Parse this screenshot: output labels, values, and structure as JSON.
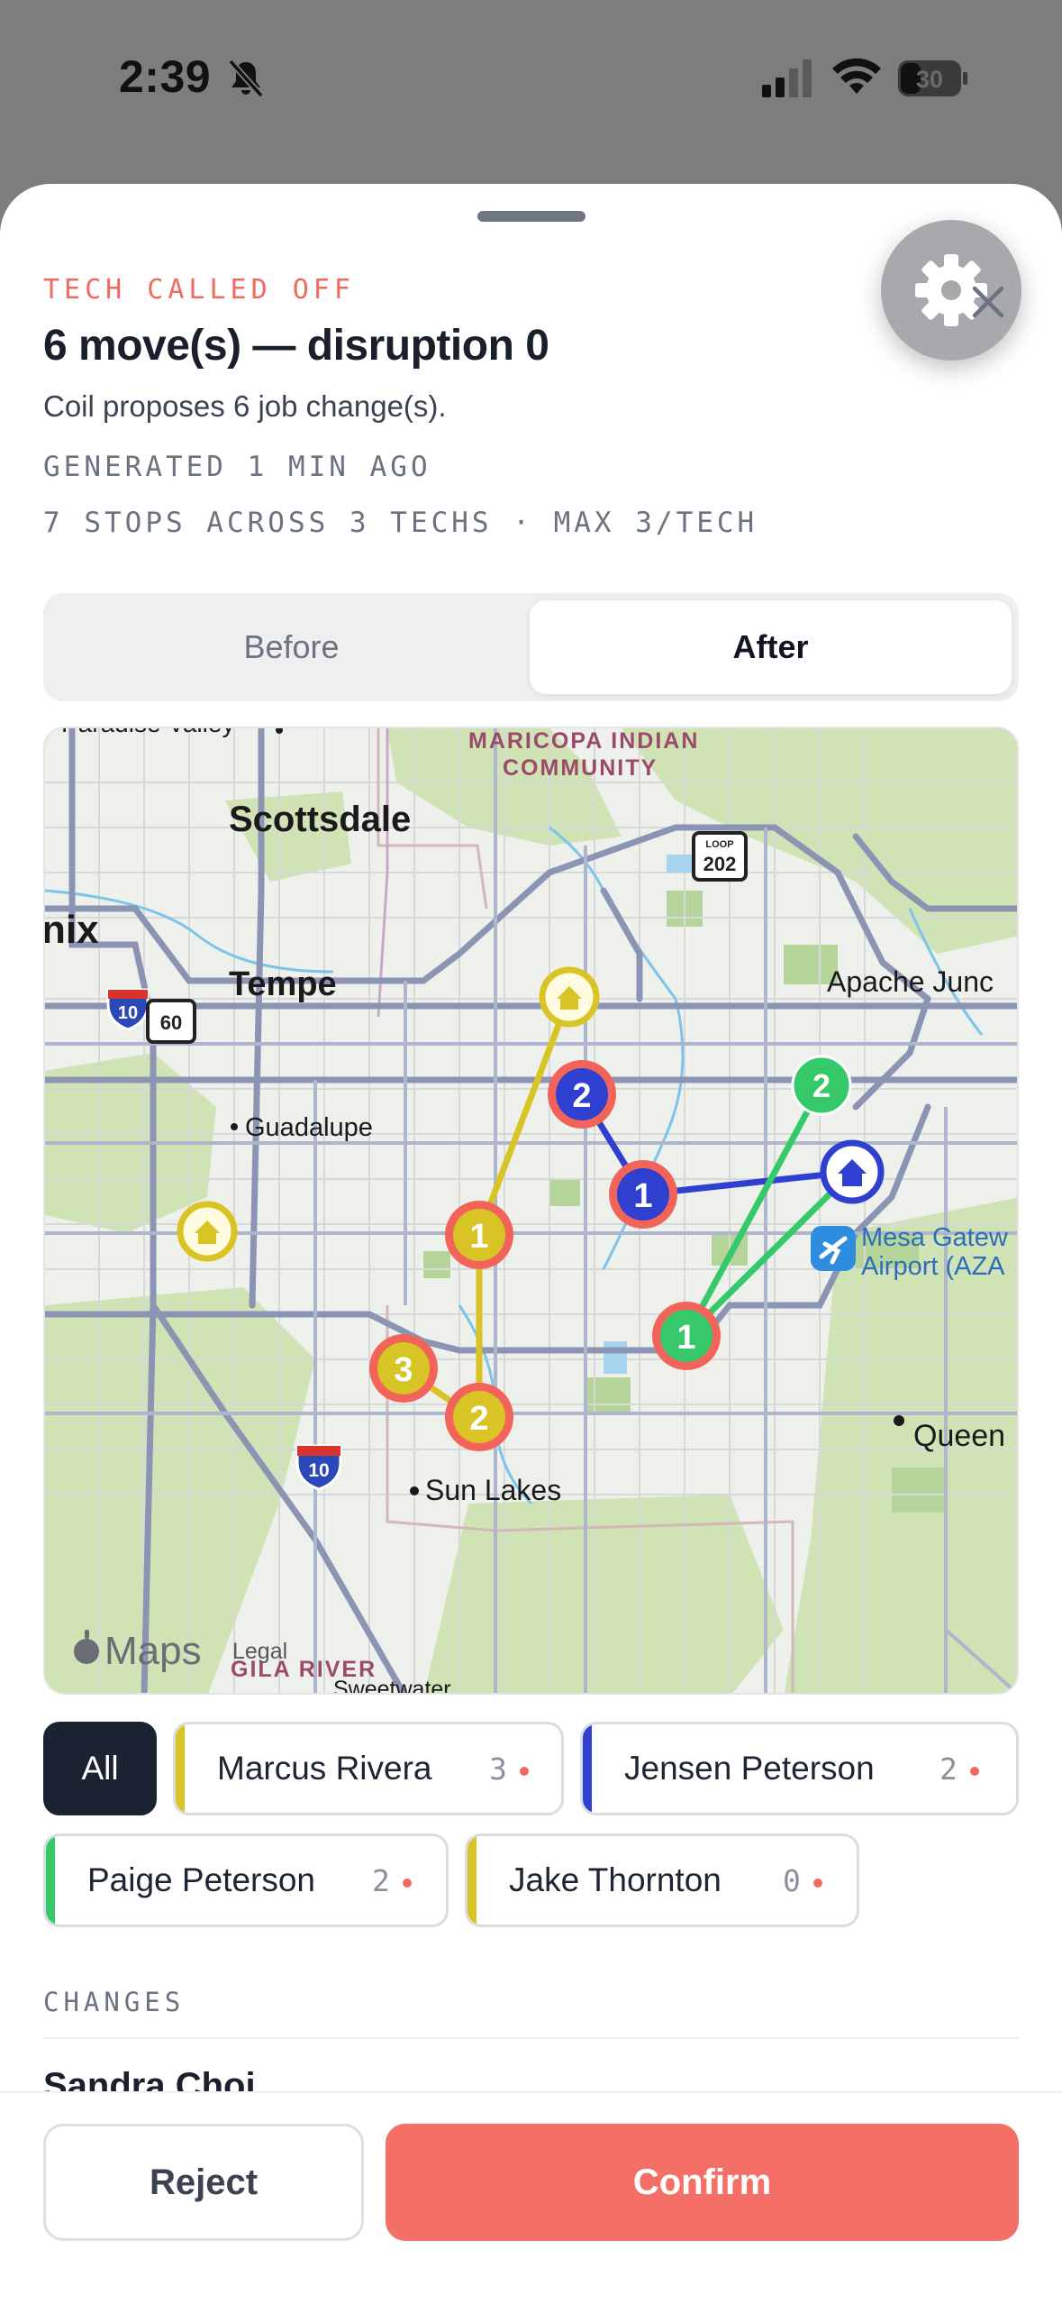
{
  "status_bar": {
    "time": "2:39",
    "battery": "30"
  },
  "sheet": {
    "kicker": "TECH CALLED OFF",
    "title": "6 move(s) — disruption 0",
    "subtitle": "Coil proposes 6 job change(s).",
    "generated": "GENERATED 1 MIN AGO",
    "stops_summary": "7 STOPS ACROSS 3 TECHS · MAX 3/TECH"
  },
  "segmented": {
    "before": "Before",
    "after": "After",
    "selected": "After"
  },
  "map": {
    "labels": {
      "paradise_valley": "Paradise Valley",
      "maricopa_1": "MARICOPA INDIAN",
      "maricopa_2": "COMMUNITY",
      "scottsdale": "Scottsdale",
      "phoenix_partial": "nix",
      "tempe": "Tempe",
      "apache": "Apache Junc",
      "guadalupe": "Guadalupe",
      "mesa_1": "Mesa Gatew",
      "mesa_2": "Airport (AZA",
      "queen": "Queen",
      "sun_lakes": "Sun Lakes",
      "gila": "GILA RIVER",
      "sweetwater": "Sweetwater",
      "maps_brand": "Maps",
      "legal": "Legal"
    },
    "shields": {
      "loop_label": "LOOP",
      "loop": "202",
      "i10_top": "10",
      "us60": "60",
      "i10_bottom": "10"
    },
    "markers": {
      "yellow_1": "1",
      "yellow_2": "2",
      "yellow_3": "3",
      "blue_1": "1",
      "blue_2": "2",
      "green_1": "1",
      "green_2": "2"
    },
    "colors": {
      "yellow": "#d8c525",
      "blue": "#2f3fcf",
      "green": "#35c96a",
      "ring": "#f2645a"
    }
  },
  "filters": {
    "all": "All",
    "techs": [
      {
        "name": "Marcus Rivera",
        "count": "3",
        "color": "#d8c525"
      },
      {
        "name": "Jensen Peterson",
        "count": "2",
        "color": "#2f3fcf"
      },
      {
        "name": "Paige Peterson",
        "count": "2",
        "color": "#35c96a"
      },
      {
        "name": "Jake Thornton",
        "count": "0",
        "color": "#d8c525"
      }
    ]
  },
  "changes": {
    "label": "CHANGES",
    "first_customer": "Sandra Choi"
  },
  "actions": {
    "reject": "Reject",
    "confirm": "Confirm"
  }
}
